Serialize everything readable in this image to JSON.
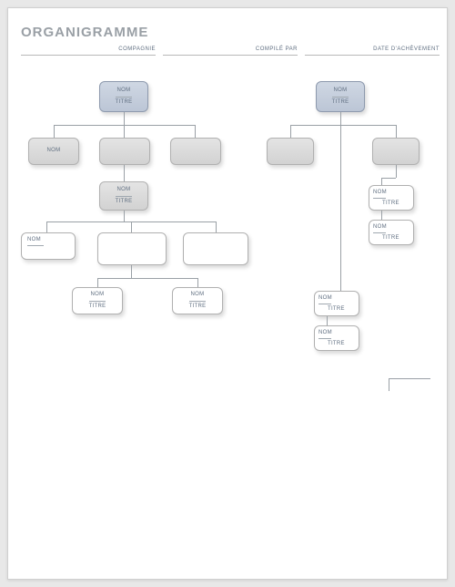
{
  "title": "ORGANIGRAMME",
  "header": {
    "company": "COMPAGNIE",
    "compiled_by": "COMPILÉ PAR",
    "completion_date": "DATE D'ACHÈVEMENT"
  },
  "labels": {
    "name": "NOM",
    "title_role": "TITRE"
  }
}
